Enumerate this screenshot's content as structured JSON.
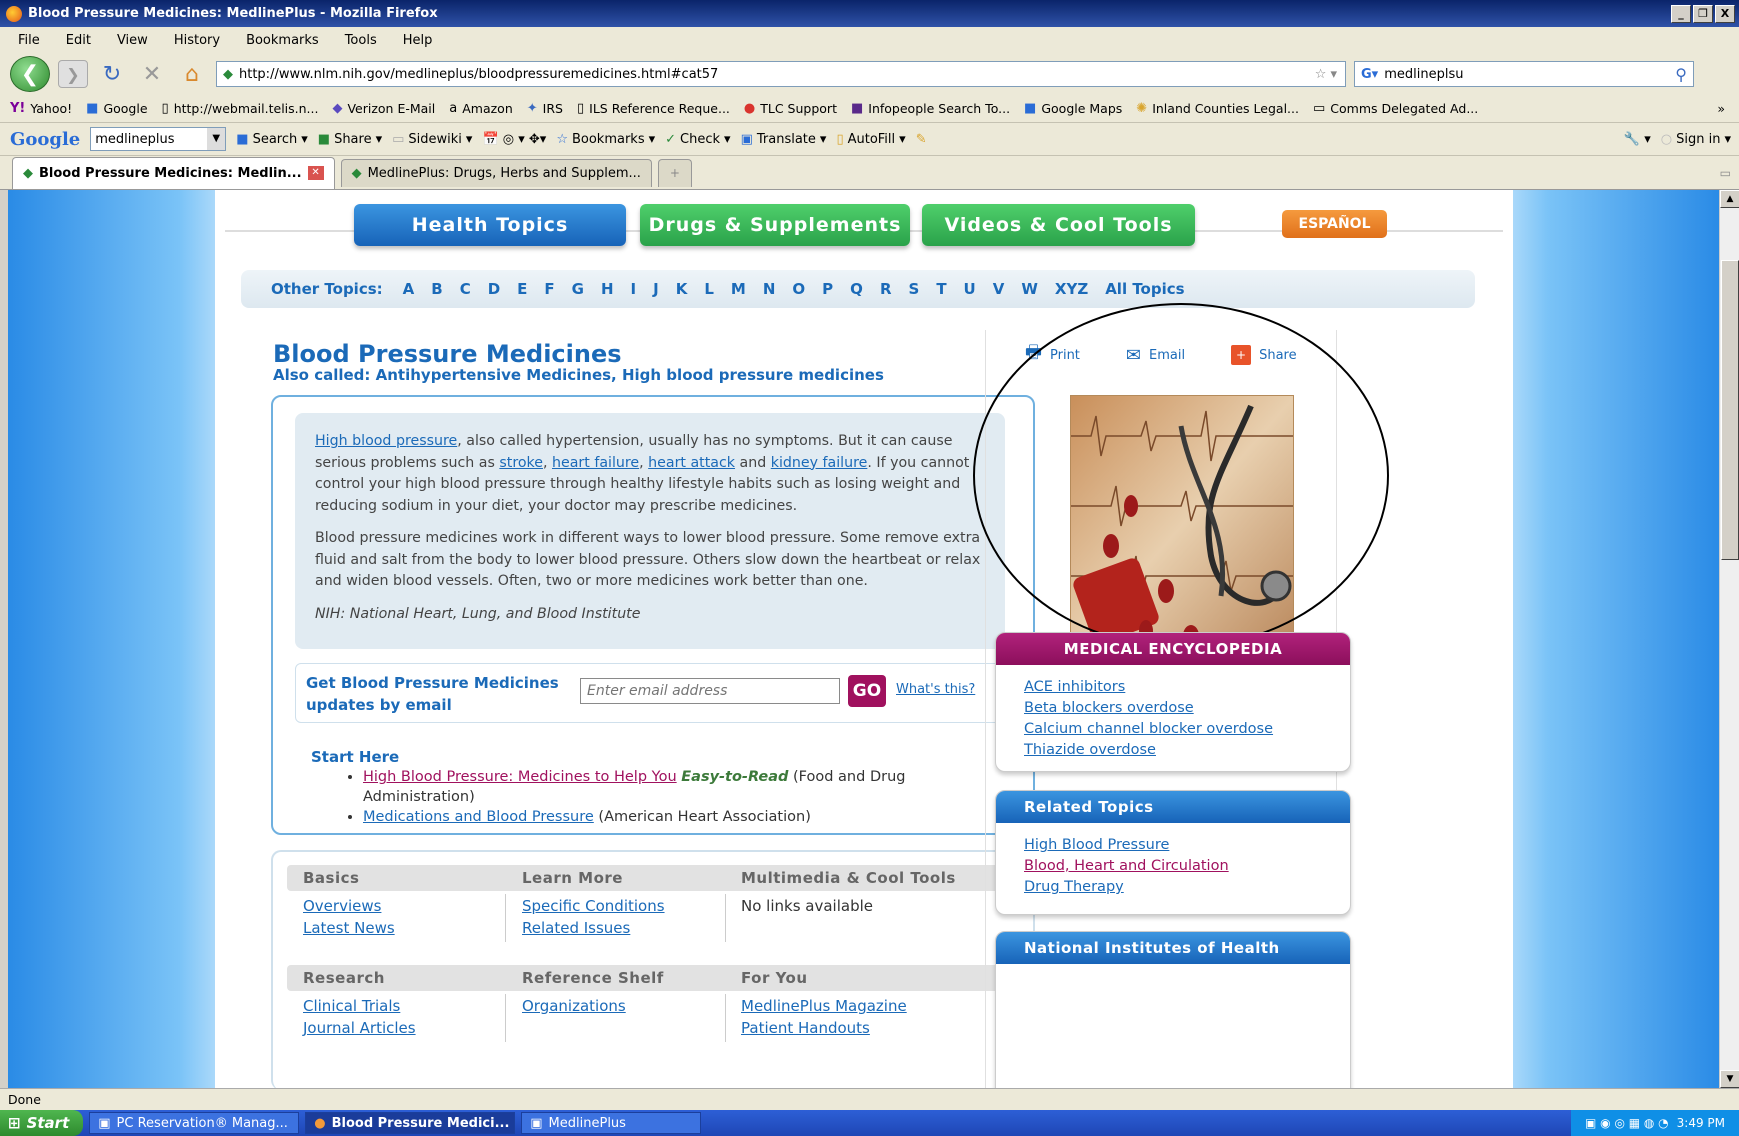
{
  "window": {
    "title": "Blood Pressure Medicines: MedlinePlus - Mozilla Firefox",
    "controls": [
      "_",
      "❐",
      "X"
    ]
  },
  "menu": [
    "File",
    "Edit",
    "View",
    "History",
    "Bookmarks",
    "Tools",
    "Help"
  ],
  "nav": {
    "url": "http://www.nlm.nih.gov/medlineplus/bloodpressuremedicines.html#cat57",
    "search": "medlineplsu"
  },
  "bookmarks": [
    "Yahoo!",
    "Google",
    "http://webmail.telis.n...",
    "Verizon E-Mail",
    "Amazon",
    "IRS",
    "ILS Reference Reque...",
    "TLC Support",
    "Infopeople Search To...",
    "Google Maps",
    "Inland Counties Legal...",
    "Comms Delegated Ad..."
  ],
  "google_toolbar": {
    "logo": "Google",
    "query": "medlineplus",
    "buttons": [
      "Search",
      "Share",
      "Sidewiki",
      "Bookmarks",
      "Check",
      "Translate",
      "AutoFill"
    ],
    "signin": "Sign in"
  },
  "tabs": [
    {
      "title": "Blood Pressure Medicines: Medlin..."
    },
    {
      "title": "MedlinePlus: Drugs, Herbs and Supplem..."
    }
  ],
  "site_nav": {
    "health": "Health Topics",
    "drugs": "Drugs & Supplements",
    "videos": "Videos & Cool Tools",
    "espanol": "ESPAÑOL"
  },
  "alpha": {
    "label": "Other Topics:",
    "letters": [
      "A",
      "B",
      "C",
      "D",
      "E",
      "F",
      "G",
      "H",
      "I",
      "J",
      "K",
      "L",
      "M",
      "N",
      "O",
      "P",
      "Q",
      "R",
      "S",
      "T",
      "U",
      "V",
      "W",
      "XYZ"
    ],
    "all": "All Topics"
  },
  "topic": {
    "title": "Blood Pressure Medicines",
    "also_called": "Also called: Antihypertensive Medicines, High blood pressure medicines",
    "summary": {
      "p1": {
        "link1": "High blood pressure",
        "t1": ", also called hypertension, usually has no symptoms. But it can cause serious problems such as ",
        "link2": "stroke",
        "t2": ", ",
        "link3": "heart failure",
        "t3": ", ",
        "link4": "heart attack",
        "t4": " and ",
        "link5": "kidney failure",
        "t5": ". If you cannot control your high blood pressure through healthy lifestyle habits such as losing weight and reducing sodium in your diet, your doctor may prescribe medicines."
      },
      "p2": "Blood pressure medicines work in different ways to lower blood pressure. Some remove extra fluid and salt from the body to lower blood pressure. Others slow down the heartbeat or relax and widen blood vessels. Often, two or more medicines work better than one.",
      "source": "NIH: National Heart, Lung, and Blood Institute"
    },
    "email": {
      "label": "Get Blood Pressure Medicines updates by email",
      "placeholder": "Enter email address",
      "go": "GO",
      "whats_this": "What's this?"
    },
    "start_here": {
      "heading": "Start Here",
      "items": [
        {
          "link": "High Blood Pressure: Medicines to Help You",
          "badge": "Easy-to-Read",
          "source": " (Food and Drug Administration)"
        },
        {
          "link": "Medications and Blood Pressure",
          "source": " (American Heart Association)"
        }
      ]
    }
  },
  "grid": {
    "row1": {
      "headers": [
        "Basics",
        "Learn More",
        "Multimedia & Cool Tools"
      ],
      "col1": [
        "Overviews",
        "Latest News"
      ],
      "col2": [
        "Specific Conditions",
        "Related Issues"
      ],
      "col3_text": "No links available"
    },
    "row2": {
      "headers": [
        "Research",
        "Reference Shelf",
        "For You"
      ],
      "col1": [
        "Clinical Trials",
        "Journal Articles"
      ],
      "col2": [
        "Organizations"
      ],
      "col3": [
        "MedlinePlus Magazine",
        "Patient Handouts"
      ]
    }
  },
  "tools": {
    "print": "Print",
    "email": "Email",
    "share": "Share"
  },
  "encyclopedia": {
    "title": "MEDICAL ENCYCLOPEDIA",
    "items": [
      "ACE inhibitors",
      "Beta blockers overdose",
      "Calcium channel blocker overdose",
      "Thiazide overdose"
    ]
  },
  "related": {
    "title": "Related Topics",
    "items": [
      "High Blood Pressure",
      "Blood, Heart and Circulation",
      "Drug Therapy"
    ]
  },
  "nih": {
    "title": "National Institutes of Health"
  },
  "status": "Done",
  "taskbar": {
    "start": "Start",
    "tasks": [
      "PC Reservation® Manag...",
      "Blood Pressure Medici...",
      "MedlinePlus"
    ],
    "clock": "3:49 PM"
  }
}
